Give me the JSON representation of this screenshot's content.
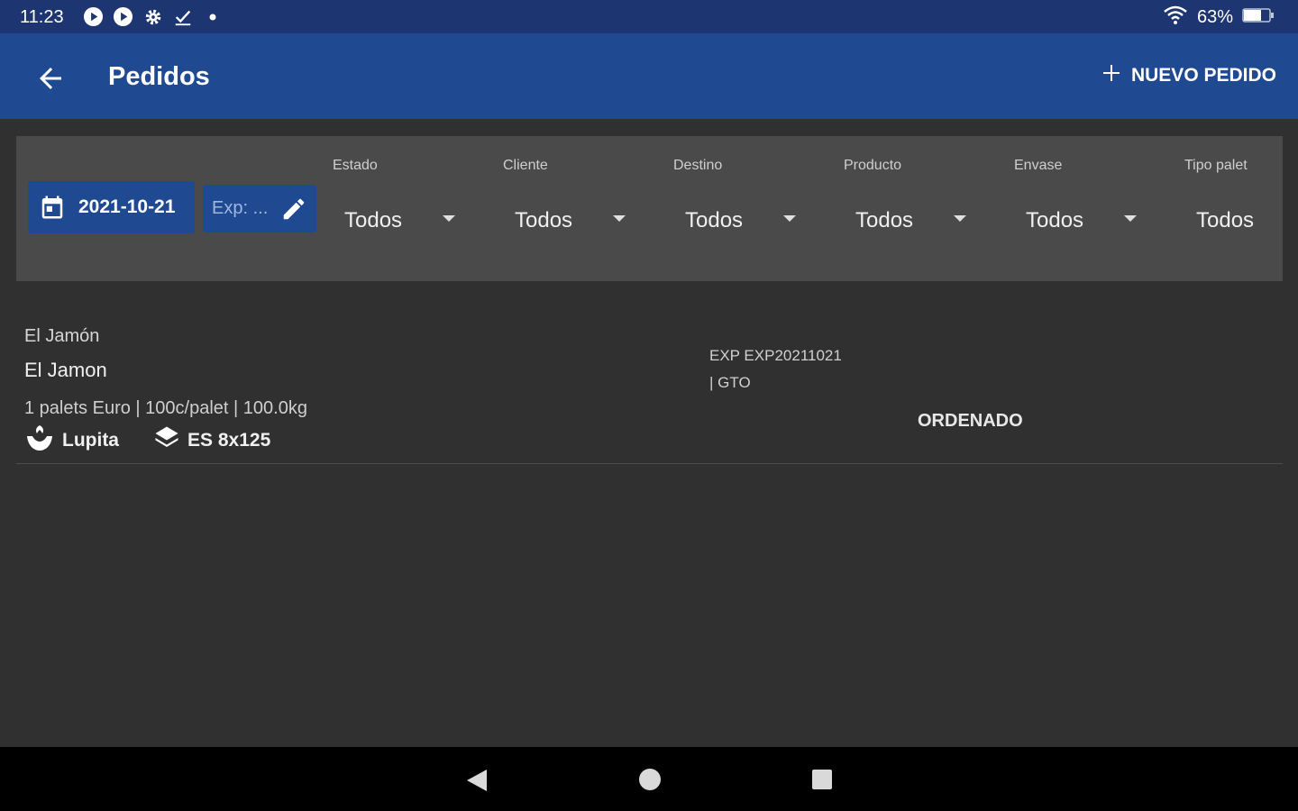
{
  "status_bar": {
    "time": "11:23",
    "battery": "63%",
    "icons": [
      "play-circle-icon",
      "play-circle-icon",
      "gear-icon",
      "download-check-icon",
      "dot-icon",
      "wifi-icon",
      "battery-icon"
    ]
  },
  "app_bar": {
    "title": "Pedidos",
    "new_order_label": "NUEVO PEDIDO"
  },
  "filters": {
    "date": "2021-10-21",
    "exp_label": "Exp: ...",
    "items": [
      {
        "label": "Estado",
        "value": "Todos"
      },
      {
        "label": "Cliente",
        "value": "Todos"
      },
      {
        "label": "Destino",
        "value": "Todos"
      },
      {
        "label": "Producto",
        "value": "Todos"
      },
      {
        "label": "Envase",
        "value": "Todos"
      },
      {
        "label": "Tipo palet",
        "value": "Todos"
      }
    ]
  },
  "orders": [
    {
      "client": "El Jamón",
      "destination": "El Jamon",
      "description": "1 palets Euro | 100c/palet | 100.0kg",
      "product": "Lupita",
      "package": "ES 8x125",
      "exp_line1": "EXP EXP20211021",
      "exp_line2": "| GTO",
      "status": "ORDENADO"
    }
  ],
  "colors": {
    "app_bar": "#1f4a91",
    "status_bar": "#1d3570",
    "background": "#303030",
    "filter_panel": "#4a4a4a"
  }
}
